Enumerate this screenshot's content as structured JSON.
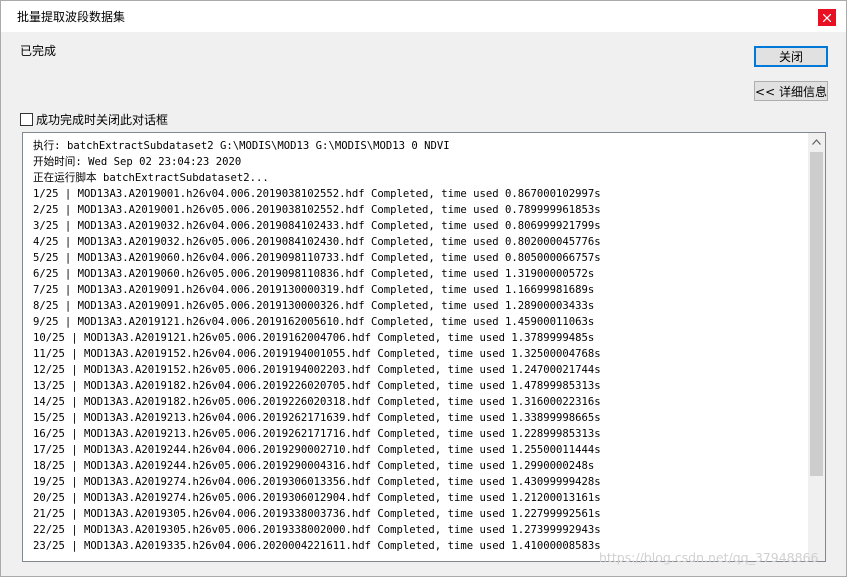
{
  "window": {
    "title": "批量提取波段数据集"
  },
  "status_text": "已完成",
  "buttons": {
    "close_label": "关闭",
    "details_label": "<< 详细信息"
  },
  "checkbox": {
    "label": "成功完成时关闭此对话框",
    "checked": false
  },
  "log": {
    "lines": [
      "执行: batchExtractSubdataset2 G:\\MODIS\\MOD13 G:\\MODIS\\MOD13 0 NDVI",
      "开始时间: Wed Sep 02 23:04:23 2020",
      "正在运行脚本 batchExtractSubdataset2...",
      "1/25 | MOD13A3.A2019001.h26v04.006.2019038102552.hdf Completed, time used 0.867000102997s",
      "2/25 | MOD13A3.A2019001.h26v05.006.2019038102552.hdf Completed, time used 0.789999961853s",
      "3/25 | MOD13A3.A2019032.h26v04.006.2019084102433.hdf Completed, time used 0.806999921799s",
      "4/25 | MOD13A3.A2019032.h26v05.006.2019084102430.hdf Completed, time used 0.802000045776s",
      "5/25 | MOD13A3.A2019060.h26v04.006.2019098110733.hdf Completed, time used 0.805000066757s",
      "6/25 | MOD13A3.A2019060.h26v05.006.2019098110836.hdf Completed, time used 1.31900000572s",
      "7/25 | MOD13A3.A2019091.h26v04.006.2019130000319.hdf Completed, time used 1.16699981689s",
      "8/25 | MOD13A3.A2019091.h26v05.006.2019130000326.hdf Completed, time used 1.28900003433s",
      "9/25 | MOD13A3.A2019121.h26v04.006.2019162005610.hdf Completed, time used 1.45900011063s",
      "10/25 | MOD13A3.A2019121.h26v05.006.2019162004706.hdf Completed, time used 1.3789999485s",
      "11/25 | MOD13A3.A2019152.h26v04.006.2019194001055.hdf Completed, time used 1.32500004768s",
      "12/25 | MOD13A3.A2019152.h26v05.006.2019194002203.hdf Completed, time used 1.24700021744s",
      "13/25 | MOD13A3.A2019182.h26v04.006.2019226020705.hdf Completed, time used 1.47899985313s",
      "14/25 | MOD13A3.A2019182.h26v05.006.2019226020318.hdf Completed, time used 1.31600022316s",
      "15/25 | MOD13A3.A2019213.h26v04.006.2019262171639.hdf Completed, time used 1.33899998665s",
      "16/25 | MOD13A3.A2019213.h26v05.006.2019262171716.hdf Completed, time used 1.22899985313s",
      "17/25 | MOD13A3.A2019244.h26v04.006.2019290002710.hdf Completed, time used 1.25500011444s",
      "18/25 | MOD13A3.A2019244.h26v05.006.2019290004316.hdf Completed, time used 1.2990000248s",
      "19/25 | MOD13A3.A2019274.h26v04.006.2019306013356.hdf Completed, time used 1.43099999428s",
      "20/25 | MOD13A3.A2019274.h26v05.006.2019306012904.hdf Completed, time used 1.21200013161s",
      "21/25 | MOD13A3.A2019305.h26v04.006.2019338003736.hdf Completed, time used 1.22799992561s",
      "22/25 | MOD13A3.A2019305.h26v05.006.2019338002000.hdf Completed, time used 1.27399992943s",
      "23/25 | MOD13A3.A2019335.h26v04.006.2020004221611.hdf Completed, time used 1.41000008583s"
    ]
  },
  "scrollbar": {
    "position": 0
  },
  "watermark": "https://blog.csdn.net/qq_37948866",
  "colors": {
    "close_button_bg": "#e81123",
    "focus_border": "#0078d7",
    "dialog_bg": "#f0f0f0"
  },
  "icons": {
    "close": "close-icon",
    "scroll_up": "chevron-up-icon"
  }
}
